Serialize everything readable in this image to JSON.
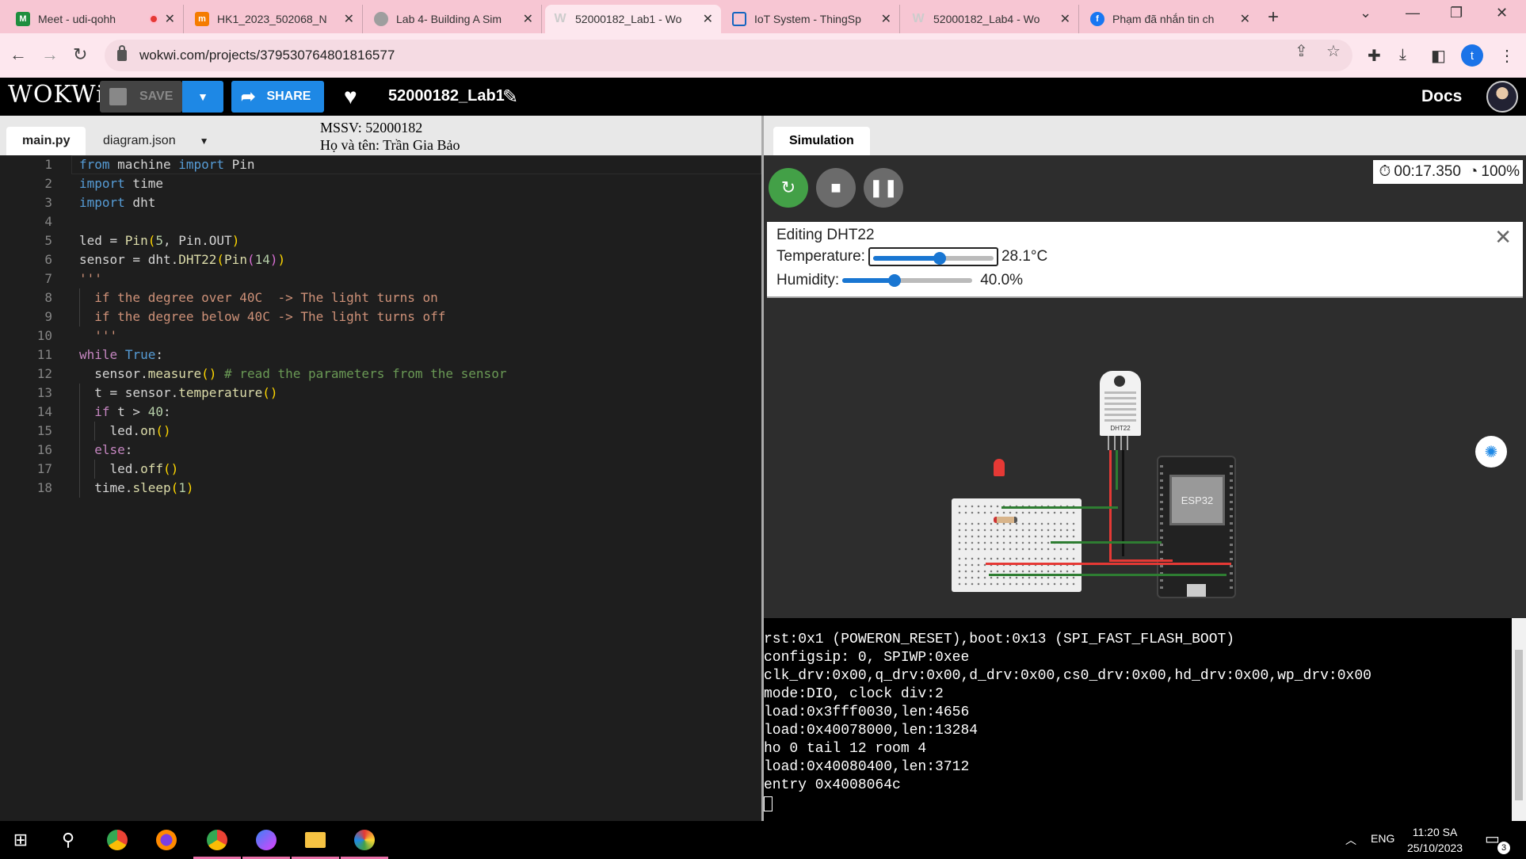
{
  "browser": {
    "tabs": [
      {
        "title": "Meet - udi-qohh",
        "color": "#1e8e3e"
      },
      {
        "title": "HK1_2023_502068_N",
        "color": "#f57c00"
      },
      {
        "title": "Lab 4- Building A Sim",
        "color": "#9e9e9e"
      },
      {
        "title": "52000182_Lab1 - Wo",
        "color": "#ffffff"
      },
      {
        "title": "IoT System - ThingSp",
        "color": "#1565c0"
      },
      {
        "title": "52000182_Lab4 - Wo",
        "color": "#ffffff"
      },
      {
        "title": "Phạm đã nhắn tin ch",
        "color": "#1877f2"
      }
    ],
    "url": "wokwi.com/projects/379530764801816577",
    "profile_initial": "t"
  },
  "wokwi": {
    "logo": "WOKWi",
    "save_label": "SAVE",
    "share_label": "SHARE",
    "project_name": "52000182_Lab1",
    "docs_label": "Docs"
  },
  "editor": {
    "tabs": [
      "main.py",
      "diagram.json"
    ],
    "note_line1": "MSSV: 52000182",
    "note_line2": "Họ và tên: Trần Gia Bảo",
    "line_numbers": [
      "1",
      "2",
      "3",
      "4",
      "5",
      "6",
      "7",
      "8",
      "9",
      "10",
      "11",
      "12",
      "13",
      "14",
      "15",
      "16",
      "17",
      "18"
    ]
  },
  "simulation": {
    "tab_label": "Simulation",
    "timer": "00:17.350",
    "speed": "100%",
    "edit_title": "Editing DHT22",
    "temperature_label": "Temperature:",
    "temperature_value": "28.1°C",
    "temperature_fraction": 0.55,
    "humidity_label": "Humidity:",
    "humidity_value": "40.0%",
    "humidity_fraction": 0.4,
    "esp_label": "ESP32",
    "dht_label": "DHT22"
  },
  "serial": {
    "lines": [
      "rst:0x1 (POWERON_RESET),boot:0x13 (SPI_FAST_FLASH_BOOT)",
      "configsip: 0, SPIWP:0xee",
      "clk_drv:0x00,q_drv:0x00,d_drv:0x00,cs0_drv:0x00,hd_drv:0x00,wp_drv:0x00",
      "mode:DIO, clock div:2",
      "load:0x3fff0030,len:4656",
      "load:0x40078000,len:13284",
      "ho 0 tail 12 room 4",
      "load:0x40080400,len:3712",
      "entry 0x4008064c"
    ]
  },
  "taskbar": {
    "lang": "ENG",
    "time": "11:20 SA",
    "date": "25/10/2023",
    "notif_count": "3"
  }
}
